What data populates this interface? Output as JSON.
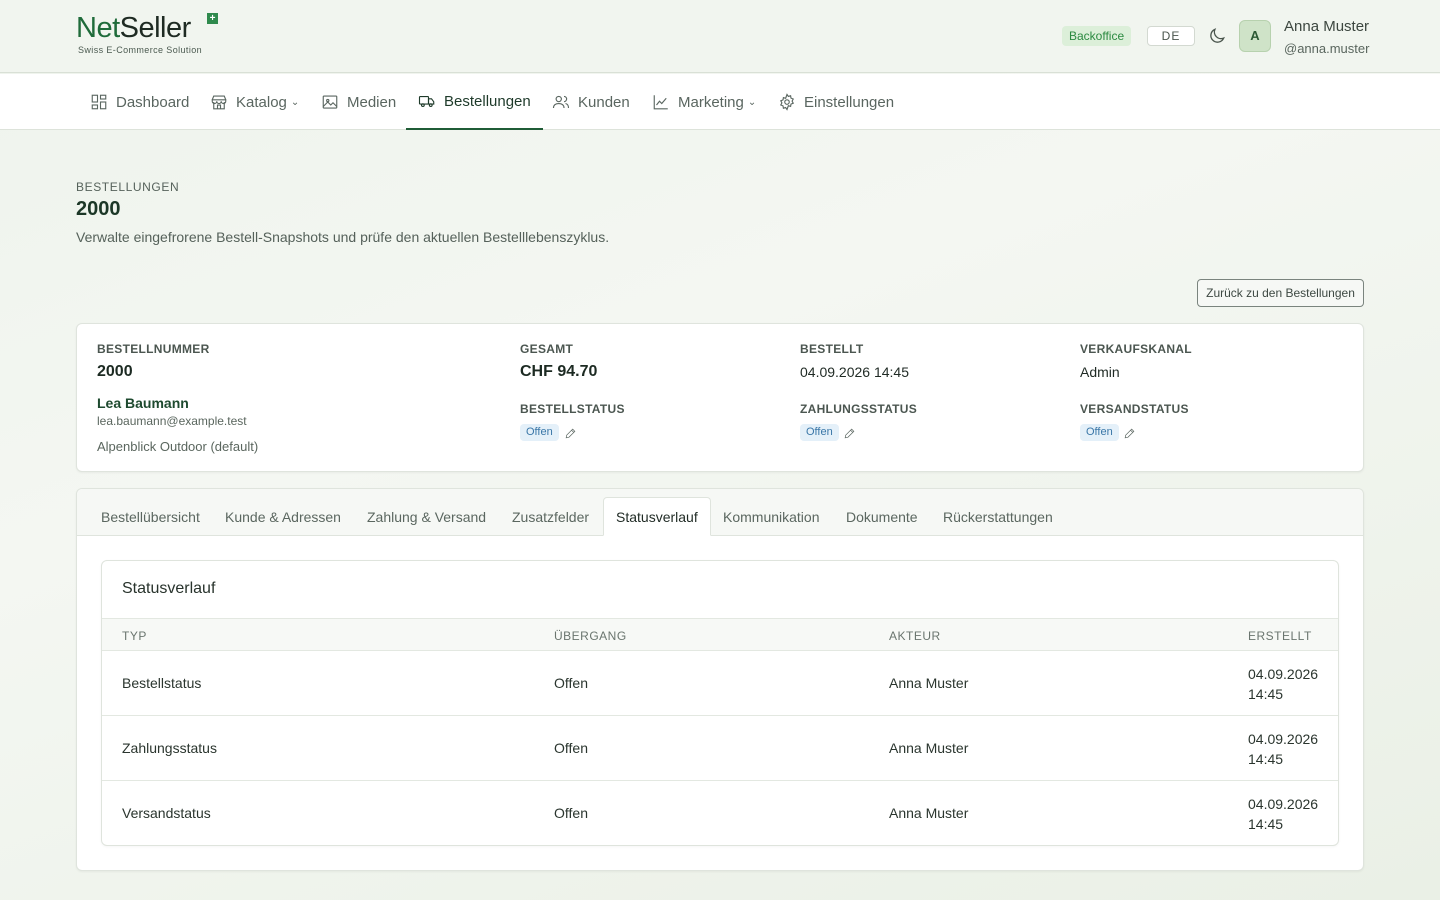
{
  "brand": {
    "net": "Net",
    "seller": "Seller",
    "plus": "+",
    "tagline": "Swiss E-Commerce Solution"
  },
  "header": {
    "badge": "Backoffice",
    "language": "DE",
    "theme_icon": "moon-icon",
    "avatar_initial": "A",
    "user_name": "Anna Muster",
    "user_handle": "@anna.muster"
  },
  "nav": {
    "items": [
      {
        "label": "Dashboard",
        "icon": "dashboard-icon"
      },
      {
        "label": "Katalog",
        "icon": "store-icon",
        "has_dropdown": true
      },
      {
        "label": "Medien",
        "icon": "image-icon"
      },
      {
        "label": "Bestellungen",
        "icon": "truck-icon",
        "active": true
      },
      {
        "label": "Kunden",
        "icon": "users-icon"
      },
      {
        "label": "Marketing",
        "icon": "chart-icon",
        "has_dropdown": true
      },
      {
        "label": "Einstellungen",
        "icon": "gear-icon"
      }
    ]
  },
  "page": {
    "eyebrow": "BESTELLUNGEN",
    "title": "2000",
    "description": "Verwalte eingefrorene Bestell-Snapshots und prüfe den aktuellen Bestelllebenszyklus.",
    "back_button": "Zurück zu den Bestellungen"
  },
  "summary": {
    "order_number_label": "BESTELLNUMMER",
    "order_number": "2000",
    "customer_name": "Lea Baumann",
    "customer_email": "lea.baumann@example.test",
    "shop": "Alpenblick Outdoor (default)",
    "total_label": "GESAMT",
    "total": "CHF 94.70",
    "ordered_label": "BESTELLT",
    "ordered": "04.09.2026 14:45",
    "channel_label": "VERKAUFSKANAL",
    "channel": "Admin",
    "order_status_label": "BESTELLSTATUS",
    "order_status": "Offen",
    "payment_status_label": "ZAHLUNGSSTATUS",
    "payment_status": "Offen",
    "shipping_status_label": "VERSANDSTATUS",
    "shipping_status": "Offen"
  },
  "tabs": [
    {
      "label": "Bestellübersicht"
    },
    {
      "label": "Kunde & Adressen"
    },
    {
      "label": "Zahlung & Versand"
    },
    {
      "label": "Zusatzfelder"
    },
    {
      "label": "Statusverlauf",
      "active": true
    },
    {
      "label": "Kommunikation"
    },
    {
      "label": "Dokumente"
    },
    {
      "label": "Rückerstattungen"
    }
  ],
  "history": {
    "title": "Statusverlauf",
    "columns": [
      "TYP",
      "ÜBERGANG",
      "AKTEUR",
      "ERSTELLT"
    ],
    "rows": [
      {
        "type": "Bestellstatus",
        "transition": "Offen",
        "actor": "Anna Muster",
        "date": "04.09.2026",
        "time": "14:45"
      },
      {
        "type": "Zahlungsstatus",
        "transition": "Offen",
        "actor": "Anna Muster",
        "date": "04.09.2026",
        "time": "14:45"
      },
      {
        "type": "Versandstatus",
        "transition": "Offen",
        "actor": "Anna Muster",
        "date": "04.09.2026",
        "time": "14:45"
      }
    ]
  }
}
